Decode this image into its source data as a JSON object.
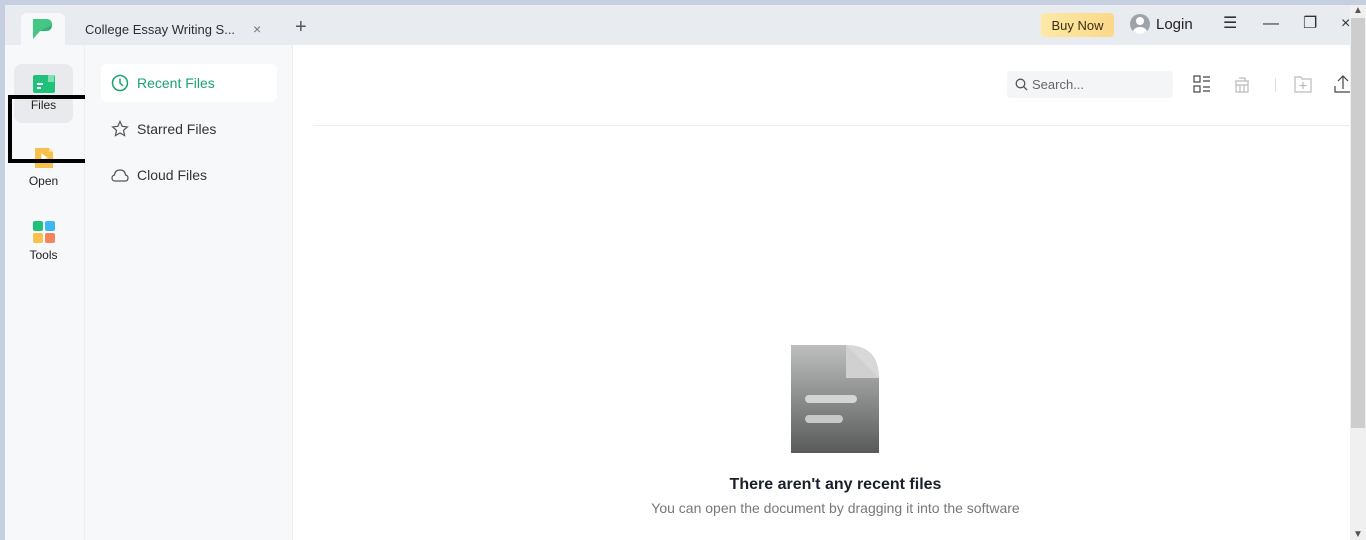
{
  "titlebar": {
    "tab_title": "College Essay Writing S...",
    "tab_close": "×",
    "new_tab": "+",
    "buy_now": "Buy Now",
    "login": "Login",
    "menu_icon": "☰",
    "minimize_icon": "—",
    "restore_icon": "❐",
    "close_icon": "×"
  },
  "navrail": {
    "items": [
      {
        "label": "Files",
        "icon": "folder-icon",
        "active": true
      },
      {
        "label": "Open",
        "icon": "open-file-icon",
        "active": false
      },
      {
        "label": "Tools",
        "icon": "tools-grid-icon",
        "active": false
      }
    ]
  },
  "sidebar": {
    "items": [
      {
        "label": "Recent Files",
        "icon": "clock-icon",
        "active": true
      },
      {
        "label": "Starred Files",
        "icon": "star-icon",
        "active": false
      },
      {
        "label": "Cloud Files",
        "icon": "cloud-icon",
        "active": false
      }
    ]
  },
  "main": {
    "search_placeholder": "Search...",
    "empty_title": "There aren't any recent files",
    "empty_subtitle": "You can open the document by dragging it into the software"
  },
  "colors": {
    "accent": "#1aa36f",
    "buy_now_bg": "#fbd88a"
  }
}
